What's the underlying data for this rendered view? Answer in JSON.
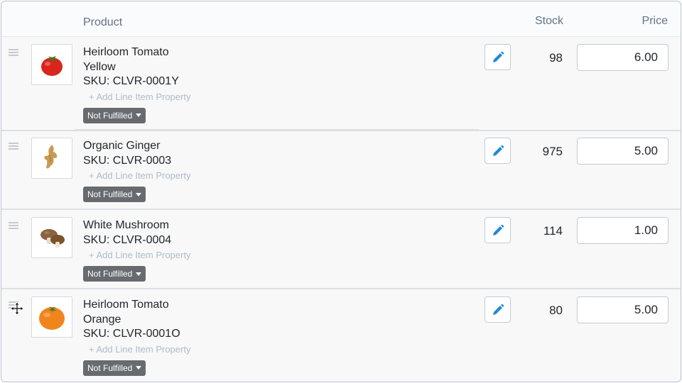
{
  "header": {
    "product": "Product",
    "stock": "Stock",
    "price": "Price"
  },
  "items": [
    {
      "lines": [
        "Heirloom Tomato",
        "Yellow",
        "SKU: CLVR-0001Y"
      ],
      "add_property": "+ Add Line Item Property",
      "status": "Not Fulfilled",
      "stock": "98",
      "price": "6.00",
      "image": "red-tomato"
    },
    {
      "lines": [
        "Organic Ginger",
        "SKU: CLVR-0003"
      ],
      "add_property": "+ Add Line Item Property",
      "status": "Not Fulfilled",
      "stock": "975",
      "price": "5.00",
      "image": "ginger-root"
    },
    {
      "lines": [
        "White Mushroom",
        "SKU: CLVR-0004"
      ],
      "add_property": "+ Add Line Item Property",
      "status": "Not Fulfilled",
      "stock": "114",
      "price": "1.00",
      "image": "mushrooms"
    },
    {
      "lines": [
        "Heirloom Tomato",
        "Orange",
        "SKU: CLVR-0001O"
      ],
      "add_property": "+ Add Line Item Property",
      "status": "Not Fulfilled",
      "stock": "80",
      "price": "5.00",
      "image": "orange-tomato"
    }
  ],
  "colors": {
    "edit_icon": "#1f8ad6",
    "status_bg": "#676b70"
  }
}
